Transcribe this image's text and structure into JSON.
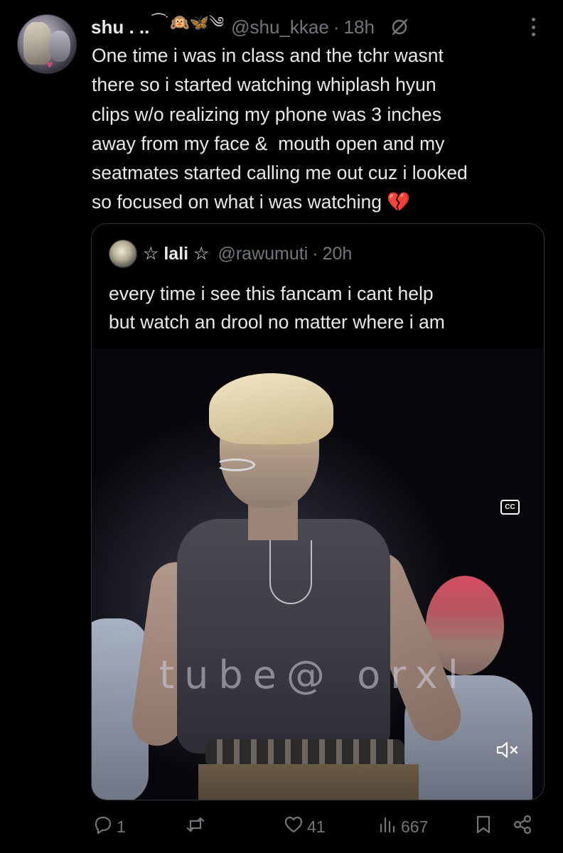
{
  "tweet": {
    "display_name": "shu . ..",
    "name_emoji": "⁀˙🙉🦋༄",
    "handle": "@shu_kkae",
    "separator": "·",
    "time": "18h",
    "text": "One time i was in class and the tchr wasnt\nthere so i started watching whiplash hyun\nclips w/o realizing my phone was 3 inches\naway from my face &  mouth open and my\nseatmates started calling me out cuz i looked\nso focused on what i was watching 💔"
  },
  "quoted_tweet": {
    "display_name": "☆ lali ☆",
    "handle": "@rawumuti",
    "separator": "·",
    "time": "20h",
    "text": "every time i see this fancam i cant help\nbut watch an drool no matter where i am",
    "video": {
      "watermark": "tube@ orxl",
      "cc_label": "CC"
    }
  },
  "actions": {
    "replies": "1",
    "reposts": "",
    "likes": "41",
    "views": "667"
  },
  "icons": {
    "grok": "grok-icon",
    "more": "more-dots-icon",
    "reply": "reply-icon",
    "repost": "repost-icon",
    "like": "heart-icon",
    "views": "views-chart-icon",
    "bookmark": "bookmark-icon",
    "share": "share-icon",
    "cc": "closed-captions-icon",
    "mute": "muted-speaker-icon"
  },
  "colors": {
    "background": "#000000",
    "text_primary": "#e7e9ea",
    "text_secondary": "#71767b",
    "border": "#2f3336",
    "heart_emoji": "#e0245e"
  }
}
